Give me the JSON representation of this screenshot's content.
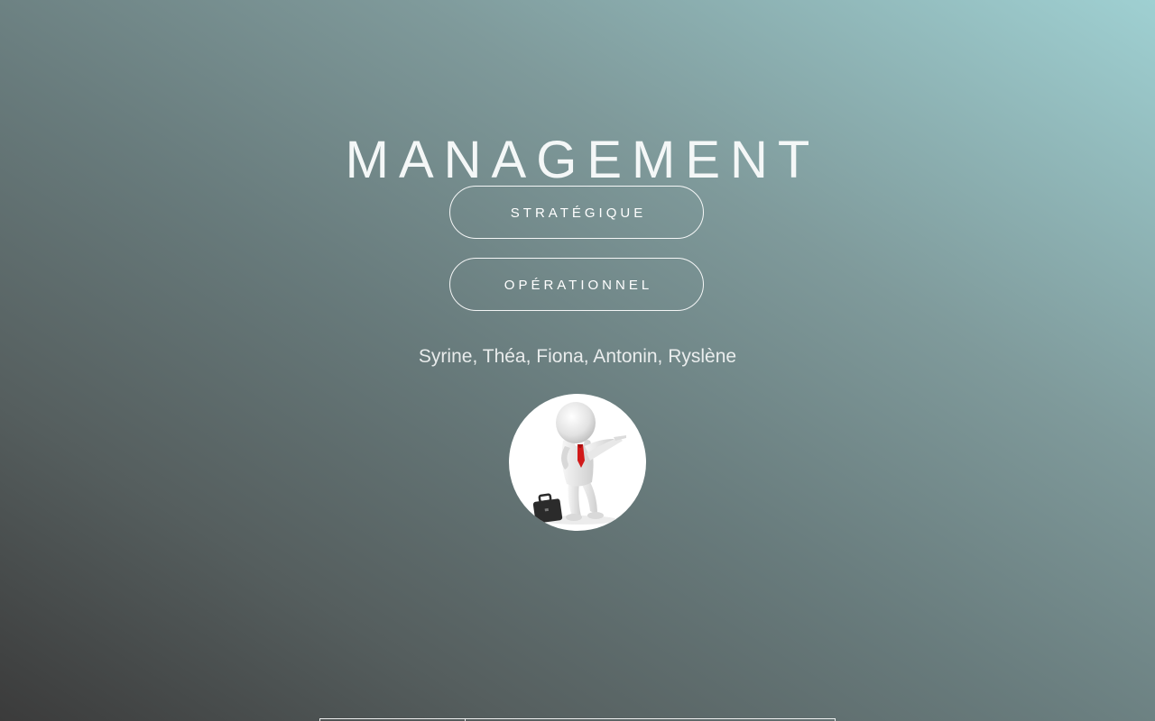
{
  "header": {
    "title": "MANAGEMENT"
  },
  "nav": {
    "buttons": [
      {
        "label": "STRATÉGIQUE"
      },
      {
        "label": "OPÉRATIONNEL"
      }
    ]
  },
  "authors": "Syrine, Théa, Fiona, Antonin, Ryslène",
  "avatar": {
    "icon": "businessman-pointing-figure",
    "tie_color": "#d11a1a",
    "briefcase_color": "#2b2b2b"
  },
  "colors": {
    "gradient_dark": "#3b3b3b",
    "gradient_light": "#9fd0d2",
    "text": "#ffffff"
  }
}
